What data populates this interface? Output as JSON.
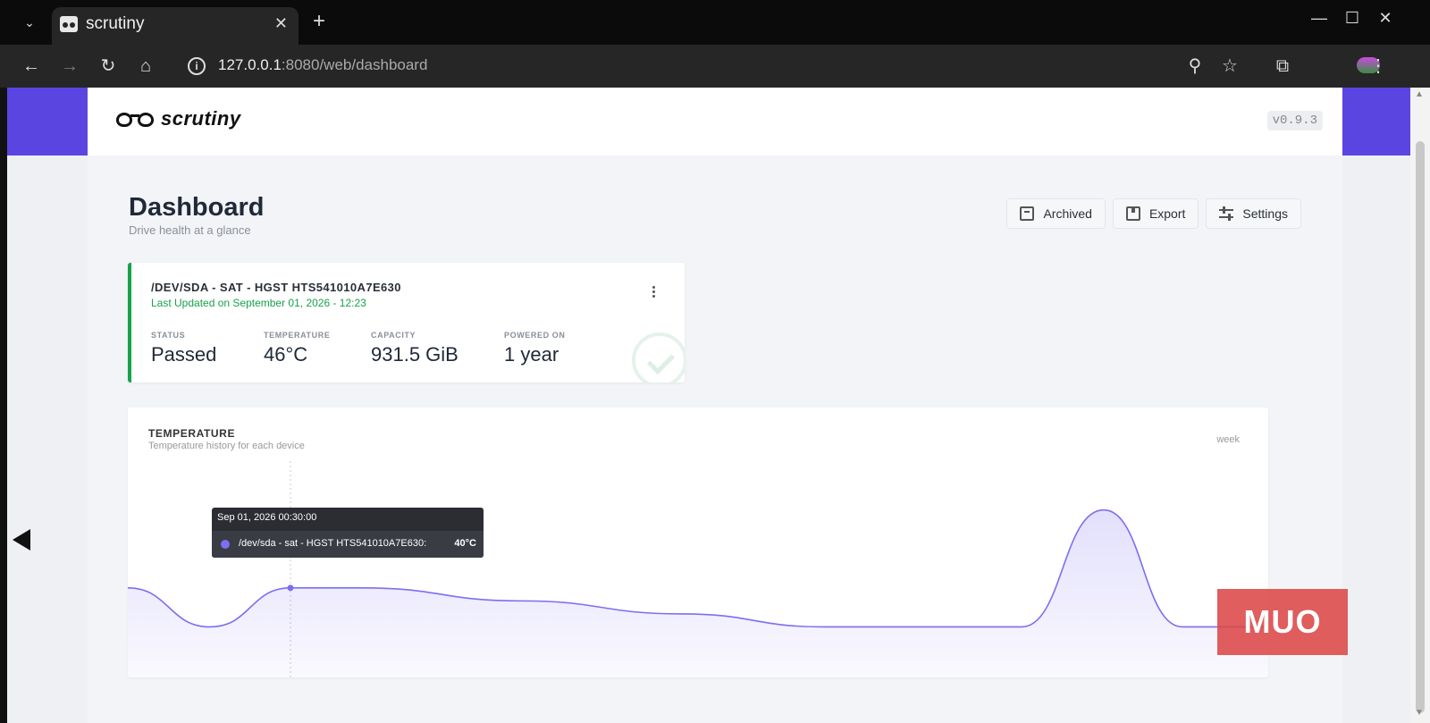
{
  "browser": {
    "tab": {
      "title": "scrutiny"
    },
    "url": {
      "host": "127.0.0.1",
      "rest": ":8080/web/dashboard"
    }
  },
  "app": {
    "logo": "scrutiny",
    "version": "v0.9.3"
  },
  "dashboard": {
    "title": "Dashboard",
    "subtitle": "Drive health at a glance",
    "actions": {
      "archived": "Archived",
      "export": "Export",
      "settings": "Settings"
    }
  },
  "device": {
    "name": "/DEV/SDA - SAT - HGST HTS541010A7E630",
    "updated": "Last Updated on September 01, 2026 - 12:23",
    "stats": [
      {
        "label": "STATUS",
        "value": "Passed"
      },
      {
        "label": "TEMPERATURE",
        "value": "46°C"
      },
      {
        "label": "CAPACITY",
        "value": "931.5 GiB"
      },
      {
        "label": "POWERED ON",
        "value": "1 year"
      }
    ]
  },
  "temperature": {
    "title": "TEMPERATURE",
    "subtitle": "Temperature history for each device",
    "range": "week",
    "tooltip": {
      "time": "Sep 01, 2026 00:30:00",
      "series": "/dev/sda - sat - HGST HTS541010A7E630:",
      "value": "40°C"
    }
  },
  "colors": {
    "accent": "#5b45e0",
    "passed": "#16a34a",
    "series": "#7c6ff0"
  },
  "watermark": "MUO",
  "chart_data": {
    "type": "area",
    "series": [
      {
        "name": "/dev/sda - sat - HGST HTS541010A7E630",
        "values": [
          40,
          37,
          40,
          40,
          39,
          38,
          37,
          37,
          37,
          46,
          37,
          37
        ]
      }
    ]
  }
}
